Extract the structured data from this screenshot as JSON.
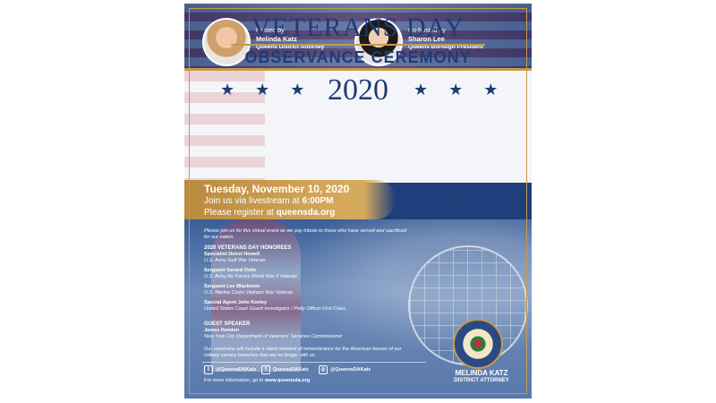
{
  "hosts": [
    {
      "label": "Hosted by",
      "name": "Melinda Katz",
      "title": "Queens District Attorney"
    },
    {
      "label": "Co-hosted by",
      "name": "Sharon Lee",
      "title": "Queens Borough President"
    }
  ],
  "title": {
    "line1": "VETERANS DAY",
    "line2": "OBSERVANCE CEREMONY",
    "year": "2020",
    "stars_left": "★ ★ ★",
    "stars_right": "★ ★ ★"
  },
  "event": {
    "date": "Tuesday, November 10, 2020",
    "stream_prefix": "Join us via livestream at ",
    "stream_time": "6:00PM",
    "register_prefix": "Please register at ",
    "register_site": "queensda.org"
  },
  "intro": "Please join us for this virtual event as we pay tribute to those who have served and sacrificed for our nation.",
  "honorees": {
    "heading": "2020 VETERANS DAY HONOREES",
    "items": [
      {
        "name": "Specialist Detrel Howell",
        "detail": "U.S. Army Gulf War Veteran"
      },
      {
        "name": "Sergeant Gerard Oeltz",
        "detail": "U.S. Army Air Forces World War II Veteran"
      },
      {
        "name": "Sergeant Lee Blackmon",
        "detail": "U.S. Marine Corps Vietnam War Veteran"
      },
      {
        "name": "Special Agent John Keeley",
        "detail": "United States Coast Guard Investigator / Petty Officer First Class"
      }
    ]
  },
  "speaker": {
    "heading": "GUEST SPEAKER",
    "name": "James Hendon",
    "detail": "New York City Department of Veterans' Services Commissioner"
  },
  "closing": "Our ceremony will include a silent moment of remembrance for the American heroes of our military service branches that are no longer with us.",
  "social": {
    "twitter": "@QueensDAKatz",
    "facebook": "QueensDAKatz",
    "instagram": "@QueensDAKatz"
  },
  "more_info_prefix": "For more information, go to ",
  "more_info_site": "www.queensda.org",
  "seal": {
    "name": "MELINDA KATZ",
    "title": "DISTRICT ATTORNEY"
  },
  "colors": {
    "navy": "#1f3c78",
    "gold": "#c79a4b",
    "panel": "#f4f5f8"
  },
  "icons": {
    "twitter": "twitter-icon",
    "facebook": "facebook-icon",
    "instagram": "instagram-icon"
  }
}
